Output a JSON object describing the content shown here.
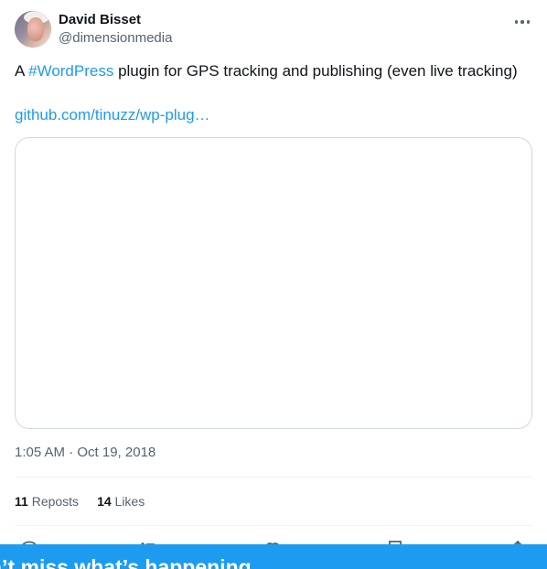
{
  "author": {
    "display_name": "David Bisset",
    "handle": "@dimensionmedia"
  },
  "tweet": {
    "text_prefix": "A ",
    "hashtag": "#WordPress",
    "text_suffix": " plugin for GPS tracking and publishing (even live tracking)",
    "link": "github.com/tinuzz/wp-plug…",
    "timestamp": "1:05 AM · Oct 19, 2018"
  },
  "stats": {
    "reposts_count": "11",
    "reposts_label": "Reposts",
    "likes_count": "14",
    "likes_label": "Likes"
  },
  "icons": [
    "more-icon",
    "reply-icon",
    "repost-icon",
    "like-icon",
    "bookmark-icon",
    "share-icon"
  ],
  "banner": {
    "text": "n’t miss what’s happening"
  },
  "colors": {
    "accent": "#1d9bf0",
    "text_primary": "#0f1419",
    "text_secondary": "#536471",
    "border": "#cfd9de"
  }
}
